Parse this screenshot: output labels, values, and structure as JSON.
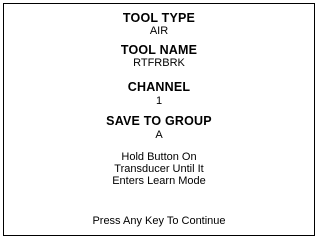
{
  "tool_type": {
    "label": "TOOL TYPE",
    "value": "AIR"
  },
  "tool_name": {
    "label": "TOOL NAME",
    "value": "RTFRBRK"
  },
  "channel": {
    "label": "CHANNEL",
    "value": "1"
  },
  "save_to_group": {
    "label": "SAVE TO GROUP",
    "value": "A"
  },
  "instruction": {
    "lines": [
      "Hold Button On",
      "Transducer Until It",
      "Enters Learn Mode"
    ]
  },
  "footer": {
    "prompt": "Press Any Key To Continue"
  }
}
